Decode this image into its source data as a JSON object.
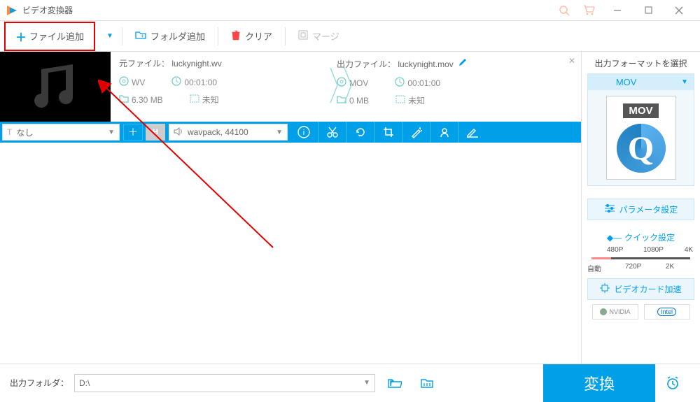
{
  "title": "ビデオ変換器",
  "toolbar": {
    "addFile": "ファイル追加",
    "addFolder": "フォルダ追加",
    "clear": "クリア",
    "merge": "マージ"
  },
  "file": {
    "srcLabel": "元ファイル：",
    "srcName": "luckynight.wv",
    "srcFormat": "WV",
    "srcDuration": "00:01:00",
    "srcSize": "6.30 MB",
    "srcRes": "未知",
    "dstLabel": "出力ファイル：",
    "dstName": "luckynight.mov",
    "dstFormat": "MOV",
    "dstDuration": "00:01:00",
    "dstSize": "0 MB",
    "dstRes": "未知"
  },
  "subtitle": {
    "iconPrefix": "T",
    "label": "なし"
  },
  "audio": {
    "track": "wavpack, 44100"
  },
  "right": {
    "title": "出力フォーマットを選択",
    "format": "MOV",
    "formatTag": "MOV",
    "param": "パラメータ設定",
    "quick": "クイック設定",
    "resolutions": {
      "auto": "自動",
      "r480": "480P",
      "r720": "720P",
      "r1080": "1080P",
      "r2k": "2K",
      "r4k": "4K"
    },
    "gpu": "ビデオカード加速",
    "nvidia": "NVIDIA",
    "intel": "Intel"
  },
  "bottom": {
    "label": "出力フォルダ：",
    "path": "D:\\",
    "convert": "変換"
  }
}
